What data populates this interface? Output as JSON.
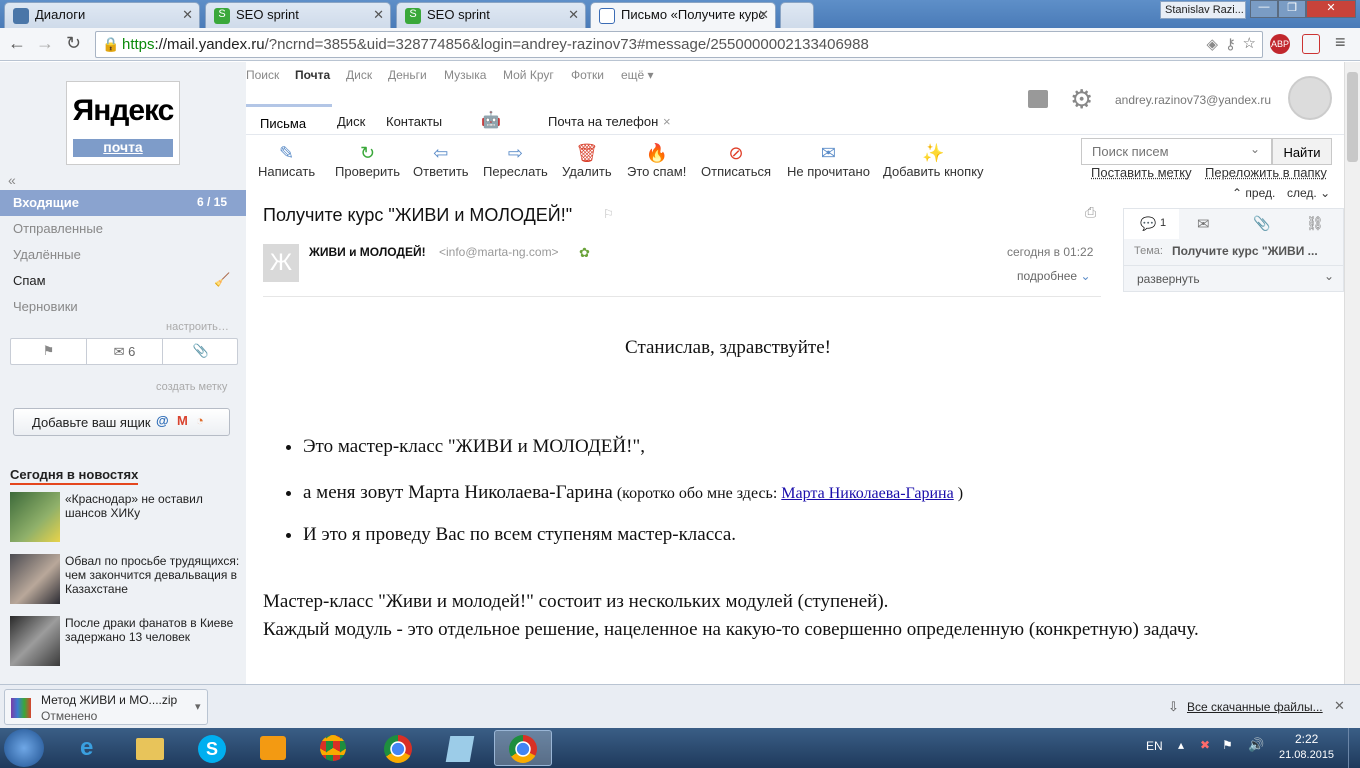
{
  "browser": {
    "tabs": [
      {
        "label": "Диалоги",
        "favicon": "vk-icon",
        "color": "#4a76a8"
      },
      {
        "label": "SEO sprint",
        "favicon": "seosprint-icon",
        "color": "#3aa83a"
      },
      {
        "label": "SEO sprint",
        "favicon": "seosprint-icon",
        "color": "#3aa83a"
      },
      {
        "label": "Письмо «Получите курс",
        "favicon": "mail-icon",
        "color": "#3b6cb5"
      }
    ],
    "user_chip": "Stanislav Razi...",
    "url_scheme": "https",
    "url_host": "://mail.yandex.ru",
    "url_rest": "/?ncrnd=3855&uid=328774856&login=andrey-razinov73#message/2550000002133406988"
  },
  "topnav": [
    "Поиск",
    "Почта",
    "Диск",
    "Деньги",
    "Музыка",
    "Мой Круг",
    "Фотки",
    "ещё ▾"
  ],
  "logo": {
    "brand": "Яндекс",
    "service": "почта"
  },
  "account": {
    "email": "andrey.razinov73@yandex.ru"
  },
  "mail_tabs": {
    "letters": "Письма",
    "disk": "Диск",
    "contacts": "Контакты",
    "phone": "Почта на телефон",
    "phone_close": "×"
  },
  "toolbar": {
    "compose": "Написать",
    "check": "Проверить",
    "reply": "Ответить",
    "forward": "Переслать",
    "delete": "Удалить",
    "spam": "Это спам!",
    "unsubscribe": "Отписаться",
    "unread": "Не прочитано",
    "add_button": "Добавить кнопку"
  },
  "search": {
    "placeholder": "Поиск писем",
    "button": "Найти"
  },
  "actions": {
    "label": "Поставить метку",
    "move": "Переложить в папку",
    "prev": "пред.",
    "next": "след."
  },
  "folders": {
    "inbox": "Входящие",
    "inbox_count": "6 / 15",
    "sent": "Отправленные",
    "deleted": "Удалённые",
    "spam": "Спам",
    "drafts": "Черновики",
    "configure": "настроить…"
  },
  "filters": {
    "unread_count": "6"
  },
  "create_label": "создать метку",
  "add_box": "Добавьте ваш ящик",
  "news": {
    "title": "Сегодня в новостях",
    "items": [
      "«Краснодар» не оставил шансов ХИКу",
      "Обвал по просьбе трудящихся: чем закончится девальвация в Казахстане",
      "После драки фанатов в Киеве задержано 13 человек"
    ]
  },
  "message": {
    "subject": "Получите курс \"ЖИВИ и МОЛОДЕЙ!\"",
    "sender_name": "ЖИВИ и МОЛОДЕЙ!",
    "sender_email": "<info@marta-ng.com>",
    "avatar_letter": "Ж",
    "date": "сегодня в 01:22",
    "details": "подробнее",
    "greeting": "Станислав, здравствуйте!",
    "bullet1": "Это мастер-класс \"ЖИВИ и МОЛОДЕЙ!\",",
    "bullet2_pre": "а меня зовут Марта Николаева-Гарина",
    "bullet2_small": " (коротко обо мне здесь: ",
    "bullet2_link": "Марта Николаева-Гарина",
    "bullet2_end": " )",
    "bullet3": "И это я проведу Вас по всем ступеням мастер-класса.",
    "para1": "Мастер-класс \"Живи и молодей!\" состоит из нескольких модулей (ступеней).",
    "para2": "Каждый модуль - это отдельное решение, нацеленное на какую-то совершенно определенную (конкретную) задачу."
  },
  "thread_panel": {
    "count": "1",
    "theme_label": "Тема:",
    "theme_value": "Получите курс \"ЖИВИ ...",
    "expand": "развернуть"
  },
  "downloads": {
    "file": "Метод  ЖИВИ и МО....zip",
    "status": "Отменено",
    "all": "Все скачанные файлы..."
  },
  "taskbar": {
    "lang": "EN",
    "time": "2:22",
    "date": "21.08.2015"
  }
}
